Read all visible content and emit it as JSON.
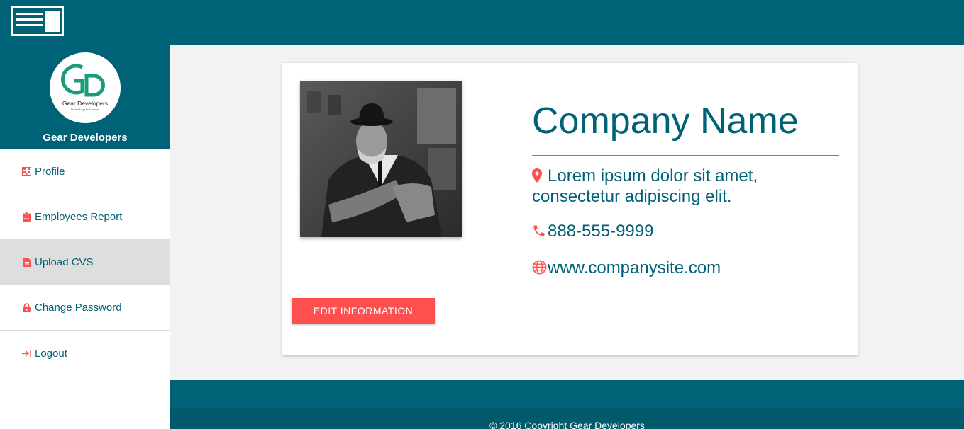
{
  "header": {
    "menu_toggle_icon": "sidebar-toggle-icon"
  },
  "sidebar": {
    "brand_name": "Gear Developers",
    "logo_text": "Gear Developers",
    "logo_tagline": "Technology that moves",
    "items": [
      {
        "label": "Profile",
        "icon": "building-icon"
      },
      {
        "label": "Employees Report",
        "icon": "clipboard-icon"
      },
      {
        "label": "Upload CVS",
        "icon": "file-icon",
        "active": true
      },
      {
        "label": "Change Password",
        "icon": "lock-icon"
      },
      {
        "label": "Logout",
        "icon": "logout-icon"
      }
    ]
  },
  "profile": {
    "company_name": "Company Name",
    "address_line1": "Lorem ipsum dolor sit amet,",
    "address_line2": "consectetur adipiscing elit.",
    "phone": "888-555-9999",
    "website": "www.companysite.com",
    "edit_button": "EDIT INFORMATION"
  },
  "footer": {
    "copyright": "© 2016 Copyright Gear Developers"
  },
  "colors": {
    "primary": "#006276",
    "accent": "#ff5050",
    "active_bg": "#dedede"
  }
}
